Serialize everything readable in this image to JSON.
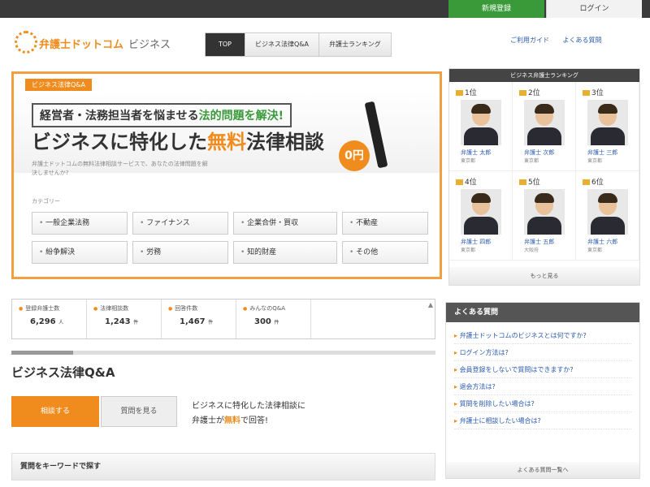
{
  "topbar": {
    "register_label": "新規登録",
    "login_label": "ログイン"
  },
  "header": {
    "logo_text": "弁護士ドットコム",
    "logo_biz": "ビジネス",
    "nav": [
      "TOP",
      "ビジネス法律Q&A",
      "弁護士ランキング"
    ],
    "links": [
      "ご利用ガイド",
      "よくある質問"
    ]
  },
  "hero": {
    "tag": "ビジネス法律Q&A",
    "line1_a": "経営者・法務担当者を悩ませる",
    "line1_b": "法的問題を解決!",
    "line2_a": "ビジネスに特化した",
    "line2_b": "無料",
    "line2_c": "法律相談",
    "badge": "0円",
    "sub": "弁護士ドットコムの無料法律相談サービスで、あなたの法律問題を解決しませんか?",
    "cat_head": "カテゴリー",
    "categories": [
      "一般企業法務",
      "ファイナンス",
      "企業合併・買収",
      "不動産",
      "紛争解決",
      "労務",
      "知的財産",
      "その他"
    ]
  },
  "ranking": {
    "title": "ビジネス弁護士ランキング",
    "items": [
      {
        "rank": "1位",
        "name": "弁護士 太郎",
        "loc": "東京都"
      },
      {
        "rank": "2位",
        "name": "弁護士 次郎",
        "loc": "東京都"
      },
      {
        "rank": "3位",
        "name": "弁護士 三郎",
        "loc": "東京都"
      },
      {
        "rank": "4位",
        "name": "弁護士 四郎",
        "loc": "東京都"
      },
      {
        "rank": "5位",
        "name": "弁護士 五郎",
        "loc": "大阪府"
      },
      {
        "rank": "6位",
        "name": "弁護士 六郎",
        "loc": "東京都"
      }
    ],
    "more": "もっと見る"
  },
  "stats": [
    {
      "label": "登録弁護士数",
      "value": "6,296",
      "unit": "人"
    },
    {
      "label": "法律相談数",
      "value": "1,243",
      "unit": "件"
    },
    {
      "label": "回答件数",
      "value": "1,467",
      "unit": "件"
    },
    {
      "label": "みんなのQ&A",
      "value": "300",
      "unit": "件"
    }
  ],
  "qa": {
    "title": "ビジネス法律Q&A",
    "ask_button": "相談する",
    "browse_button": "質問を見る",
    "text_a": "ビジネスに特化した法律相談に",
    "text_b": "弁護士が",
    "text_c": "無料",
    "text_d": "で回答!",
    "keyword_label": "質問をキーワードで探す"
  },
  "faq": {
    "title": "よくある質問",
    "items": [
      "弁護士ドットコムのビジネスとは何ですか?",
      "ログイン方法は?",
      "会員登録をしないで質問はできますか?",
      "退会方法は?",
      "質問を削除したい場合は?",
      "弁護士に相談したい場合は?"
    ],
    "more": "よくある質問一覧へ"
  }
}
